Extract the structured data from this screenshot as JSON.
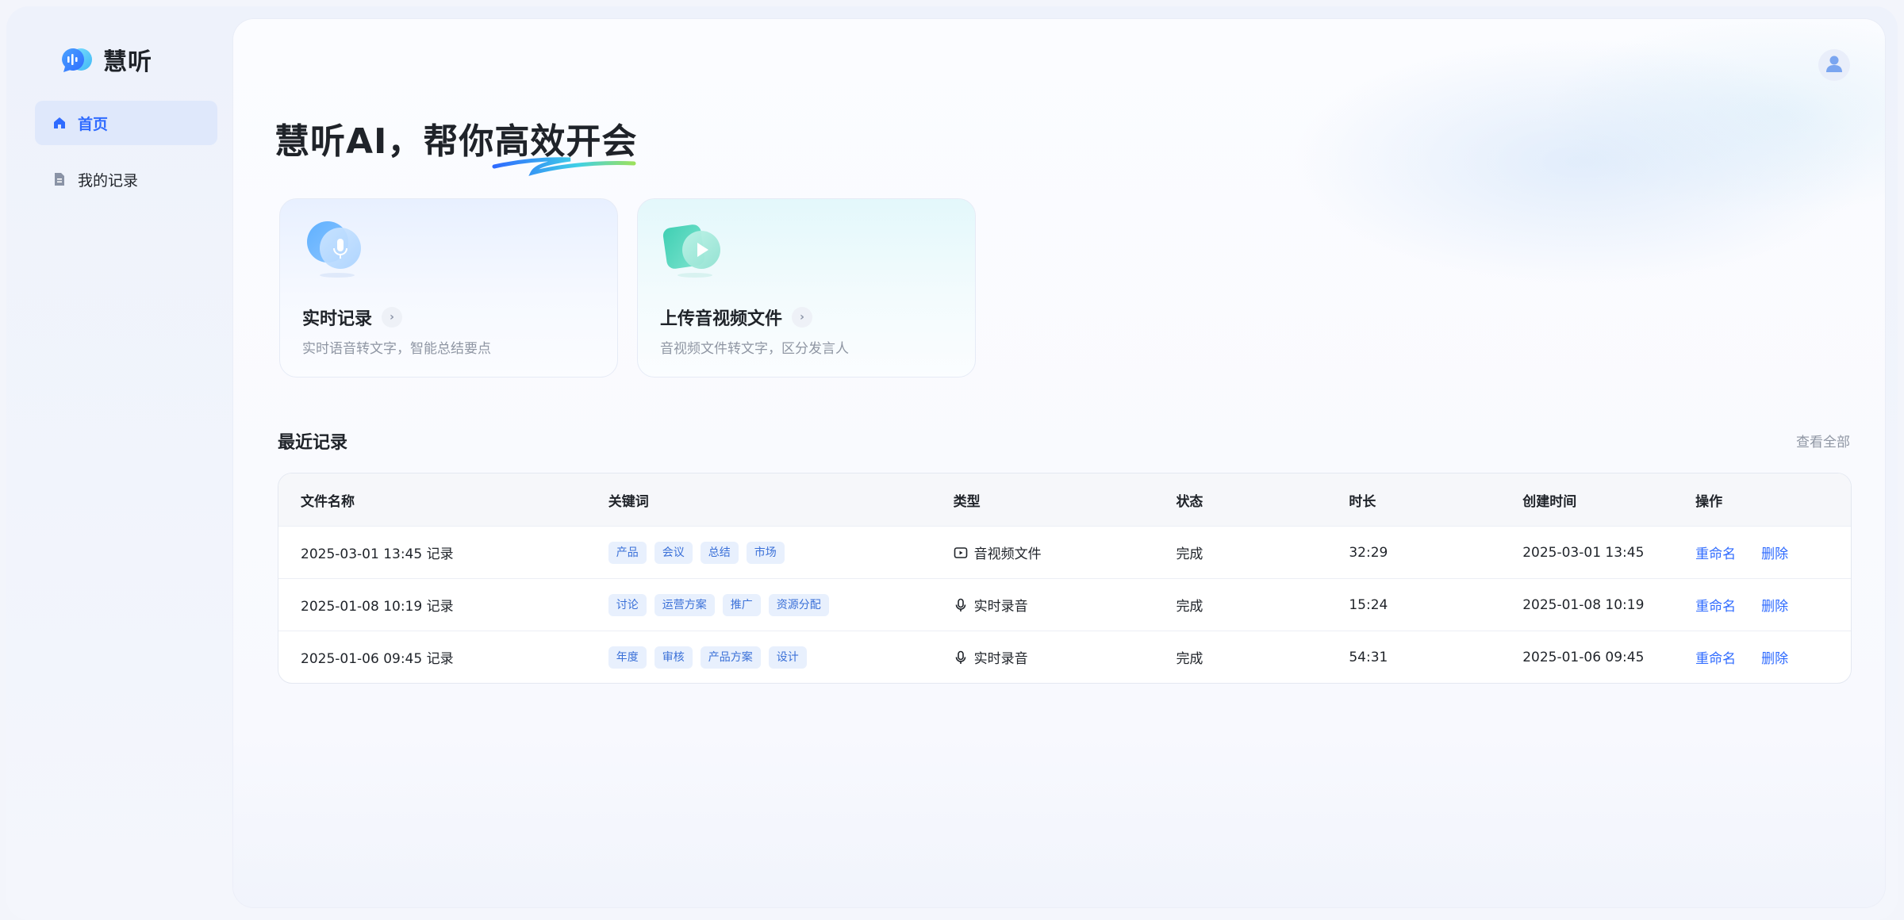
{
  "app": {
    "name": "慧听"
  },
  "sidebar": {
    "items": [
      {
        "label": "首页",
        "active": true
      },
      {
        "label": "我的记录",
        "active": false
      }
    ]
  },
  "hero": {
    "prefix": "慧听AI，帮你",
    "highlight": "高效开会"
  },
  "cards": [
    {
      "title": "实时记录",
      "desc": "实时语音转文字，智能总结要点",
      "icon": "microphone-icon"
    },
    {
      "title": "上传音视频文件",
      "desc": "音视频文件转文字，区分发言人",
      "icon": "play-icon"
    }
  ],
  "recent": {
    "title": "最近记录",
    "view_all": "查看全部",
    "columns": [
      "文件名称",
      "关键词",
      "类型",
      "状态",
      "时长",
      "创建时间",
      "操作"
    ],
    "rows": [
      {
        "name": "2025-03-01 13:45 记录",
        "tags": [
          "产品",
          "会议",
          "总结",
          "市场"
        ],
        "type": "音视频文件",
        "type_icon": "video-file-icon",
        "status": "完成",
        "duration": "32:29",
        "created": "2025-03-01 13:45",
        "rename": "重命名",
        "delete": "删除"
      },
      {
        "name": "2025-01-08 10:19 记录",
        "tags": [
          "讨论",
          "运营方案",
          "推广",
          "资源分配"
        ],
        "type": "实时录音",
        "type_icon": "microphone-icon",
        "status": "完成",
        "duration": "15:24",
        "created": "2025-01-08 10:19",
        "rename": "重命名",
        "delete": "删除"
      },
      {
        "name": "2025-01-06 09:45 记录",
        "tags": [
          "年度",
          "审核",
          "产品方案",
          "设计"
        ],
        "type": "实时录音",
        "type_icon": "microphone-icon",
        "status": "完成",
        "duration": "54:31",
        "created": "2025-01-06 09:45",
        "rename": "重命名",
        "delete": "删除"
      }
    ]
  },
  "colors": {
    "accent": "#2f6bff",
    "tag_bg": "#e8f0fd",
    "tag_text": "#3a70d8",
    "nav_active_bg": "#dfe8fb"
  }
}
